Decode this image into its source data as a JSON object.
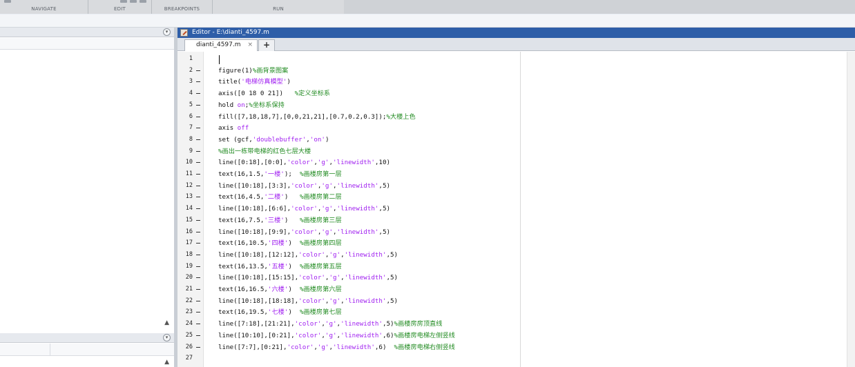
{
  "toolstrip": {
    "groups": [
      "NAVIGATE",
      "EDIT",
      "BREAKPOINTS",
      "RUN"
    ]
  },
  "editor": {
    "title": "Editor - E:\\dianti_4597.m",
    "tab_label": "dianti_4597.m",
    "tab_close": "×",
    "tab_add": "+"
  },
  "code_lines": [
    {
      "n": "1",
      "parts": []
    },
    {
      "n": "2",
      "parts": [
        {
          "t": "figure(1)"
        },
        {
          "t": "%画背景图案",
          "k": "c"
        }
      ]
    },
    {
      "n": "3",
      "parts": [
        {
          "t": "title("
        },
        {
          "t": "'电梯仿真模型'",
          "k": "s"
        },
        {
          "t": ")"
        }
      ]
    },
    {
      "n": "4",
      "parts": [
        {
          "t": "axis([0 18 0 21])   "
        },
        {
          "t": "%定义坐标系",
          "k": "c"
        }
      ]
    },
    {
      "n": "5",
      "parts": [
        {
          "t": "hold "
        },
        {
          "t": "on",
          "k": "s"
        },
        {
          "t": ";"
        },
        {
          "t": "%坐标系保持",
          "k": "c"
        }
      ]
    },
    {
      "n": "6",
      "parts": [
        {
          "t": "fill([7,18,18,7],[0,0,21,21],[0.7,0.2,0.3]);"
        },
        {
          "t": "%大楼上色",
          "k": "c"
        }
      ]
    },
    {
      "n": "7",
      "parts": [
        {
          "t": "axis "
        },
        {
          "t": "off",
          "k": "s"
        }
      ]
    },
    {
      "n": "8",
      "parts": [
        {
          "t": "set (gcf,"
        },
        {
          "t": "'doublebuffer'",
          "k": "s"
        },
        {
          "t": ","
        },
        {
          "t": "'on'",
          "k": "s"
        },
        {
          "t": ")"
        }
      ]
    },
    {
      "n": "9",
      "parts": [
        {
          "t": "%画出一栋带电梯的红色七层大楼",
          "k": "c"
        }
      ]
    },
    {
      "n": "10",
      "parts": [
        {
          "t": "line([0:18],[0:0],"
        },
        {
          "t": "'color'",
          "k": "s"
        },
        {
          "t": ","
        },
        {
          "t": "'g'",
          "k": "s"
        },
        {
          "t": ","
        },
        {
          "t": "'linewidth'",
          "k": "s"
        },
        {
          "t": ",10)"
        }
      ]
    },
    {
      "n": "11",
      "parts": [
        {
          "t": "text(16,1.5,"
        },
        {
          "t": "'一楼'",
          "k": "s"
        },
        {
          "t": ");  "
        },
        {
          "t": "%画楼房第一层",
          "k": "c"
        }
      ]
    },
    {
      "n": "12",
      "parts": [
        {
          "t": "line([10:18],[3:3],"
        },
        {
          "t": "'color'",
          "k": "s"
        },
        {
          "t": ","
        },
        {
          "t": "'g'",
          "k": "s"
        },
        {
          "t": ","
        },
        {
          "t": "'linewidth'",
          "k": "s"
        },
        {
          "t": ",5)"
        }
      ]
    },
    {
      "n": "13",
      "parts": [
        {
          "t": "text(16,4.5,"
        },
        {
          "t": "'二楼'",
          "k": "s"
        },
        {
          "t": ")   "
        },
        {
          "t": "%画楼房第二层",
          "k": "c"
        }
      ]
    },
    {
      "n": "14",
      "parts": [
        {
          "t": "line([10:18],[6:6],"
        },
        {
          "t": "'color'",
          "k": "s"
        },
        {
          "t": ","
        },
        {
          "t": "'g'",
          "k": "s"
        },
        {
          "t": ","
        },
        {
          "t": "'linewidth'",
          "k": "s"
        },
        {
          "t": ",5)"
        }
      ]
    },
    {
      "n": "15",
      "parts": [
        {
          "t": "text(16,7.5,"
        },
        {
          "t": "'三楼'",
          "k": "s"
        },
        {
          "t": ")   "
        },
        {
          "t": "%画楼房第三层",
          "k": "c"
        }
      ]
    },
    {
      "n": "16",
      "parts": [
        {
          "t": "line([10:18],[9:9],"
        },
        {
          "t": "'color'",
          "k": "s"
        },
        {
          "t": ","
        },
        {
          "t": "'g'",
          "k": "s"
        },
        {
          "t": ","
        },
        {
          "t": "'linewidth'",
          "k": "s"
        },
        {
          "t": ",5)"
        }
      ]
    },
    {
      "n": "17",
      "parts": [
        {
          "t": "text(16,10.5,"
        },
        {
          "t": "'四楼'",
          "k": "s"
        },
        {
          "t": ")  "
        },
        {
          "t": "%画楼房第四层",
          "k": "c"
        }
      ]
    },
    {
      "n": "18",
      "parts": [
        {
          "t": "line([10:18],[12:12],"
        },
        {
          "t": "'color'",
          "k": "s"
        },
        {
          "t": ","
        },
        {
          "t": "'g'",
          "k": "s"
        },
        {
          "t": ","
        },
        {
          "t": "'linewidth'",
          "k": "s"
        },
        {
          "t": ",5)"
        }
      ]
    },
    {
      "n": "19",
      "parts": [
        {
          "t": "text(16,13.5,"
        },
        {
          "t": "'五楼'",
          "k": "s"
        },
        {
          "t": ")  "
        },
        {
          "t": "%画楼房第五层",
          "k": "c"
        }
      ]
    },
    {
      "n": "20",
      "parts": [
        {
          "t": "line([10:18],[15:15],"
        },
        {
          "t": "'color'",
          "k": "s"
        },
        {
          "t": ","
        },
        {
          "t": "'g'",
          "k": "s"
        },
        {
          "t": ","
        },
        {
          "t": "'linewidth'",
          "k": "s"
        },
        {
          "t": ",5)"
        }
      ]
    },
    {
      "n": "21",
      "parts": [
        {
          "t": "text(16,16.5,"
        },
        {
          "t": "'六楼'",
          "k": "s"
        },
        {
          "t": ")  "
        },
        {
          "t": "%画楼房第六层",
          "k": "c"
        }
      ]
    },
    {
      "n": "22",
      "parts": [
        {
          "t": "line([10:18],[18:18],"
        },
        {
          "t": "'color'",
          "k": "s"
        },
        {
          "t": ","
        },
        {
          "t": "'g'",
          "k": "s"
        },
        {
          "t": ","
        },
        {
          "t": "'linewidth'",
          "k": "s"
        },
        {
          "t": ",5)"
        }
      ]
    },
    {
      "n": "23",
      "parts": [
        {
          "t": "text(16,19.5,"
        },
        {
          "t": "'七楼'",
          "k": "s"
        },
        {
          "t": ")  "
        },
        {
          "t": "%画楼房第七层",
          "k": "c"
        }
      ]
    },
    {
      "n": "24",
      "parts": [
        {
          "t": "line([7:18],[21:21],"
        },
        {
          "t": "'color'",
          "k": "s"
        },
        {
          "t": ","
        },
        {
          "t": "'g'",
          "k": "s"
        },
        {
          "t": ","
        },
        {
          "t": "'linewidth'",
          "k": "s"
        },
        {
          "t": ",5)"
        },
        {
          "t": "%画楼房房顶直线",
          "k": "c"
        }
      ]
    },
    {
      "n": "25",
      "parts": [
        {
          "t": "line([10:10],[0:21],"
        },
        {
          "t": "'color'",
          "k": "s"
        },
        {
          "t": ","
        },
        {
          "t": "'g'",
          "k": "s"
        },
        {
          "t": ","
        },
        {
          "t": "'linewidth'",
          "k": "s"
        },
        {
          "t": ",6)"
        },
        {
          "t": "%画楼房电梯左侧竖线",
          "k": "c"
        }
      ]
    },
    {
      "n": "26",
      "parts": [
        {
          "t": "line([7:7],[0:21],"
        },
        {
          "t": "'color'",
          "k": "s"
        },
        {
          "t": ","
        },
        {
          "t": "'g'",
          "k": "s"
        },
        {
          "t": ","
        },
        {
          "t": "'linewidth'",
          "k": "s"
        },
        {
          "t": ",6)  "
        },
        {
          "t": "%画楼房电梯右侧竖线",
          "k": "c"
        }
      ]
    },
    {
      "n": "27",
      "parts": []
    }
  ]
}
